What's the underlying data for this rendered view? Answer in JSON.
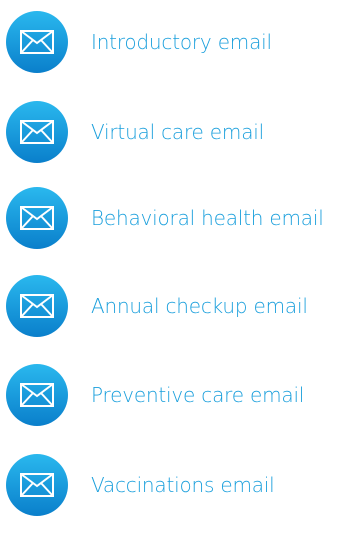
{
  "colors": {
    "link": "#1a9fdc",
    "icon_gradient_top": "#2ab8ee",
    "icon_gradient_bottom": "#0a7fcb",
    "icon_glyph": "#ffffff"
  },
  "emails": [
    {
      "label": "Introductory email",
      "icon": "envelope-icon"
    },
    {
      "label": "Virtual care email",
      "icon": "envelope-icon"
    },
    {
      "label": "Behavioral health email",
      "icon": "envelope-icon"
    },
    {
      "label": "Annual checkup email",
      "icon": "envelope-icon"
    },
    {
      "label": "Preventive care email",
      "icon": "envelope-icon"
    },
    {
      "label": "Vaccinations email",
      "icon": "envelope-icon"
    }
  ]
}
